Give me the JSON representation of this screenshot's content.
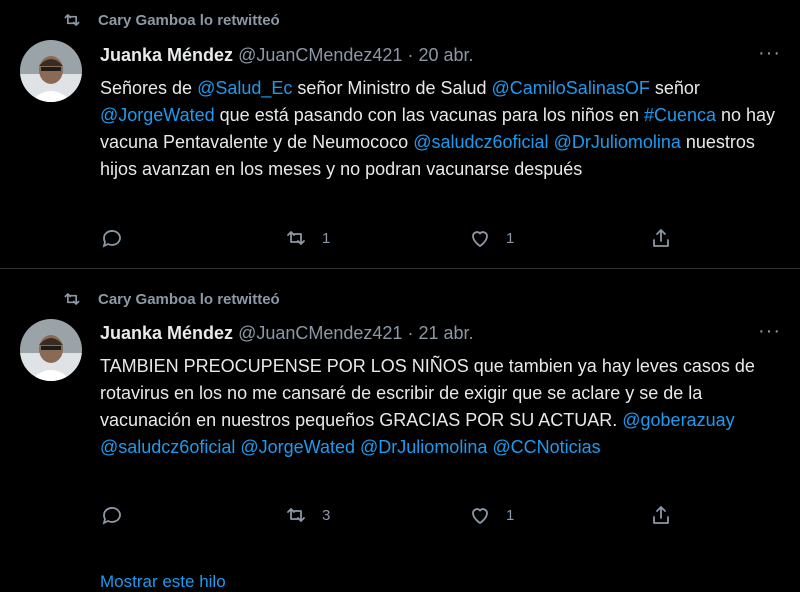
{
  "tweets": [
    {
      "retweet_by": "Cary Gamboa lo retwitteó",
      "author_name": "Juanka Méndez",
      "handle": "@JuanCMendez421",
      "separator": " · ",
      "date": "20 abr.",
      "more": "···",
      "body": [
        {
          "t": "Señores de "
        },
        {
          "t": "@Salud_Ec",
          "link": true
        },
        {
          "t": " señor Ministro de Salud "
        },
        {
          "t": "@CamiloSalinasOF",
          "link": true
        },
        {
          "t": " señor "
        },
        {
          "t": "@JorgeWated",
          "link": true
        },
        {
          "t": " que está pasando con las vacunas para los niños en "
        },
        {
          "t": "#Cuenca",
          "link": true
        },
        {
          "t": " no hay vacuna Pentavalente y de Neumococo "
        },
        {
          "t": "@saludcz6oficial",
          "link": true
        },
        {
          "t": " "
        },
        {
          "t": "@DrJuliomolina",
          "link": true
        },
        {
          "t": " nuestros hijos avanzan en los meses y no podran vacunarse después"
        }
      ],
      "retweet_count": "1",
      "like_count": "1"
    },
    {
      "retweet_by": "Cary Gamboa lo retwitteó",
      "author_name": "Juanka Méndez",
      "handle": "@JuanCMendez421",
      "separator": " · ",
      "date": "21 abr.",
      "more": "···",
      "body": [
        {
          "t": "TAMBIEN PREOCUPENSE POR LOS NIÑOS que tambien ya hay leves casos de rotavirus en los no me cansaré de escribir de exigir que se aclare y se de la vacunación en nuestros pequeños GRACIAS POR SU ACTUAR. "
        },
        {
          "t": "@goberazuay",
          "link": true
        },
        {
          "t": " "
        },
        {
          "t": "@saludcz6oficial",
          "link": true
        },
        {
          "t": " "
        },
        {
          "t": "@JorgeWated",
          "link": true
        },
        {
          "t": " "
        },
        {
          "t": "@DrJuliomolina",
          "link": true
        },
        {
          "t": " "
        },
        {
          "t": "@CCNoticias",
          "link": true
        }
      ],
      "retweet_count": "3",
      "like_count": "1"
    }
  ],
  "show_thread": "Mostrar este hilo",
  "colors": {
    "background": "#000000",
    "link": "#1d9bf0",
    "muted": "#8b98a5",
    "text": "#e7e9ea"
  },
  "icons": [
    "retweet-icon",
    "reply-icon",
    "like-icon",
    "share-icon",
    "more-icon"
  ]
}
